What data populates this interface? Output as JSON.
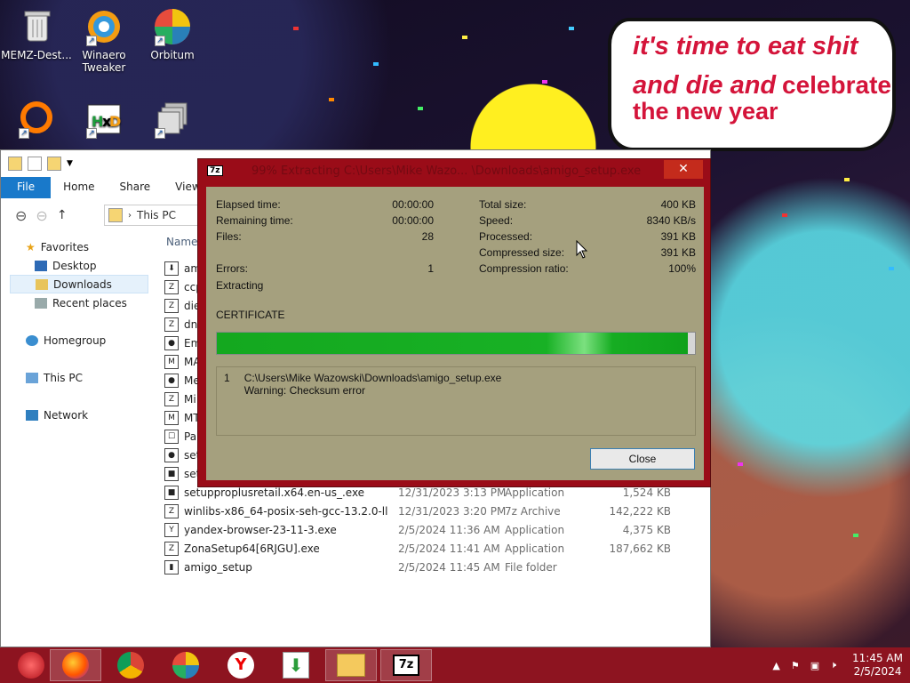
{
  "desktop_icons": [
    {
      "label": "MEMZ-Dest...",
      "icon": "recycle-bin-icon"
    },
    {
      "label": "Winaero Tweaker",
      "icon": "winaero-icon"
    },
    {
      "label": "Orbitum",
      "icon": "orbitum-icon"
    },
    {
      "label": "",
      "icon": "orange-ring-icon"
    },
    {
      "label": "",
      "icon": "hxd-icon"
    },
    {
      "label": "",
      "icon": "stack-icon"
    }
  ],
  "speech_bubble": {
    "line1": "it's time to eat shit",
    "line2": "and die and",
    "line2b": "celebrate",
    "line3": "the new year"
  },
  "explorer": {
    "ribbon": {
      "file": "File",
      "home": "Home",
      "share": "Share",
      "view": "View"
    },
    "address": {
      "this_pc": "This PC"
    },
    "nav": {
      "favorites": "Favorites",
      "desktop": "Desktop",
      "downloads": "Downloads",
      "recent": "Recent places",
      "homegroup": "Homegroup",
      "this_pc": "This PC",
      "network": "Network"
    },
    "column_name": "Name",
    "files": [
      {
        "name": "am",
        "date": "",
        "type": "",
        "size": ""
      },
      {
        "name": "ccp",
        "date": "",
        "type": "",
        "size": ""
      },
      {
        "name": "die",
        "date": "",
        "type": "",
        "size": ""
      },
      {
        "name": "dn",
        "date": "",
        "type": "",
        "size": ""
      },
      {
        "name": "Em",
        "date": "",
        "type": "",
        "size": ""
      },
      {
        "name": "MA",
        "date": "",
        "type": "",
        "size": ""
      },
      {
        "name": "Me",
        "date": "",
        "type": "",
        "size": ""
      },
      {
        "name": "Mi",
        "date": "",
        "type": "",
        "size": ""
      },
      {
        "name": "MT",
        "date": "",
        "type": "",
        "size": ""
      },
      {
        "name": "Pap",
        "date": "",
        "type": "",
        "size": ""
      },
      {
        "name": "set",
        "date": "",
        "type": "",
        "size": ""
      },
      {
        "name": "set",
        "date": "",
        "type": "",
        "size": ""
      },
      {
        "name": "setupproplusretail.x64.en-us_.exe",
        "date": "12/31/2023 3:13 PM",
        "type": "Application",
        "size": "1,524 KB"
      },
      {
        "name": "winlibs-x86_64-posix-seh-gcc-13.2.0-llv...",
        "date": "12/31/2023 3:20 PM",
        "type": "7z Archive",
        "size": "142,222 KB"
      },
      {
        "name": "yandex-browser-23-11-3.exe",
        "date": "2/5/2024 11:36 AM",
        "type": "Application",
        "size": "4,375 KB"
      },
      {
        "name": "ZonaSetup64[6RJGU].exe",
        "date": "2/5/2024 11:41 AM",
        "type": "Application",
        "size": "187,662 KB"
      },
      {
        "name": "amigo_setup",
        "date": "2/5/2024 11:45 AM",
        "type": "File folder",
        "size": ""
      }
    ]
  },
  "dialog": {
    "icon_label": "7z",
    "title": "99% Extracting C:\\Users\\Mike Wazo... \\Downloads\\amigo_setup.exe",
    "close_glyph": "✕",
    "stats_left": [
      {
        "k": "Elapsed time:",
        "v": "00:00:00"
      },
      {
        "k": "Remaining time:",
        "v": "00:00:00"
      },
      {
        "k": "Files:",
        "v": "28"
      },
      {
        "k": "Errors:",
        "v": "1"
      }
    ],
    "stats_right": [
      {
        "k": "Total size:",
        "v": "400 KB"
      },
      {
        "k": "Speed:",
        "v": "8340 KB/s"
      },
      {
        "k": "Processed:",
        "v": "391 KB"
      },
      {
        "k": "Compressed size:",
        "v": "391 KB"
      },
      {
        "k": "Compression ratio:",
        "v": "100%"
      }
    ],
    "status": "Extracting",
    "current_file": "CERTIFICATE",
    "progress_fraction": 0.985,
    "log": {
      "index": "1",
      "path": "C:\\Users\\Mike Wazowski\\Downloads\\amigo_setup.exe",
      "message": "Warning: Checksum error"
    },
    "close_button": "Close"
  },
  "taskbar": {
    "apps": [
      "firefox-icon",
      "chrome-icon",
      "orbitum-icon",
      "yandex-icon",
      "download-icon",
      "file-explorer-icon",
      "7zip-icon"
    ],
    "clock_time": "11:45 AM",
    "clock_date": "2/5/2024"
  },
  "colors": {
    "dialog_frame": "#9a0c18",
    "dialog_body": "#a5a07e",
    "taskbar": "#8d1420",
    "progress": "#14a81f",
    "bubble_text": "#d4143a"
  }
}
